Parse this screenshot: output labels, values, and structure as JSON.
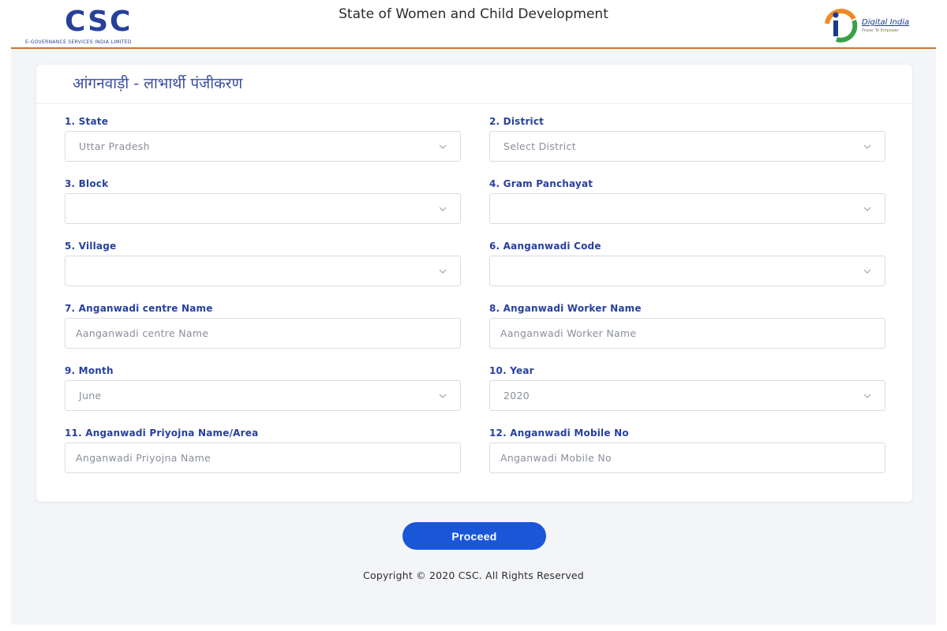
{
  "header": {
    "logo_text": "CSC",
    "logo_subtitle": "E-GOVERNANCE SERVICES INDIA LIMITED",
    "title": "State of Women and Child Development",
    "digital_india": "Digital India",
    "digital_india_tagline": "Power To Empower",
    "accent_color": "#c8742f"
  },
  "form": {
    "title": "आंगनवाड़ी - लाभार्थी पंजीकरण",
    "fields": [
      {
        "label": "1. State",
        "type": "select",
        "value": "Uttar Pradesh",
        "placeholder": ""
      },
      {
        "label": "2. District",
        "type": "select",
        "value": "Select District",
        "placeholder": ""
      },
      {
        "label": "3. Block",
        "type": "select",
        "value": "",
        "placeholder": ""
      },
      {
        "label": "4. Gram Panchayat",
        "type": "select",
        "value": "",
        "placeholder": ""
      },
      {
        "label": "5. Village",
        "type": "select",
        "value": "",
        "placeholder": ""
      },
      {
        "label": "6. Aanganwadi Code",
        "type": "select",
        "value": "",
        "placeholder": ""
      },
      {
        "label": "7. Anganwadi centre Name",
        "type": "text",
        "value": "",
        "placeholder": "Aanganwadi centre Name"
      },
      {
        "label": "8. Anganwadi Worker Name",
        "type": "text",
        "value": "",
        "placeholder": "Aanganwadi Worker Name"
      },
      {
        "label": "9. Month",
        "type": "select",
        "value": "June",
        "placeholder": ""
      },
      {
        "label": "10. Year",
        "type": "select",
        "value": "2020",
        "placeholder": ""
      },
      {
        "label": "11. Anganwadi Priyojna Name/Area",
        "type": "text",
        "value": "",
        "placeholder": "Anganwadi Priyojna Name"
      },
      {
        "label": "12. Anganwadi Mobile No",
        "type": "text",
        "value": "",
        "placeholder": "Anganwadi Mobile No"
      }
    ]
  },
  "actions": {
    "proceed_label": "Proceed",
    "button_color": "#1a57d8"
  },
  "footer": {
    "copyright": "Copyright © 2020 CSC. All Rights Reserved"
  }
}
